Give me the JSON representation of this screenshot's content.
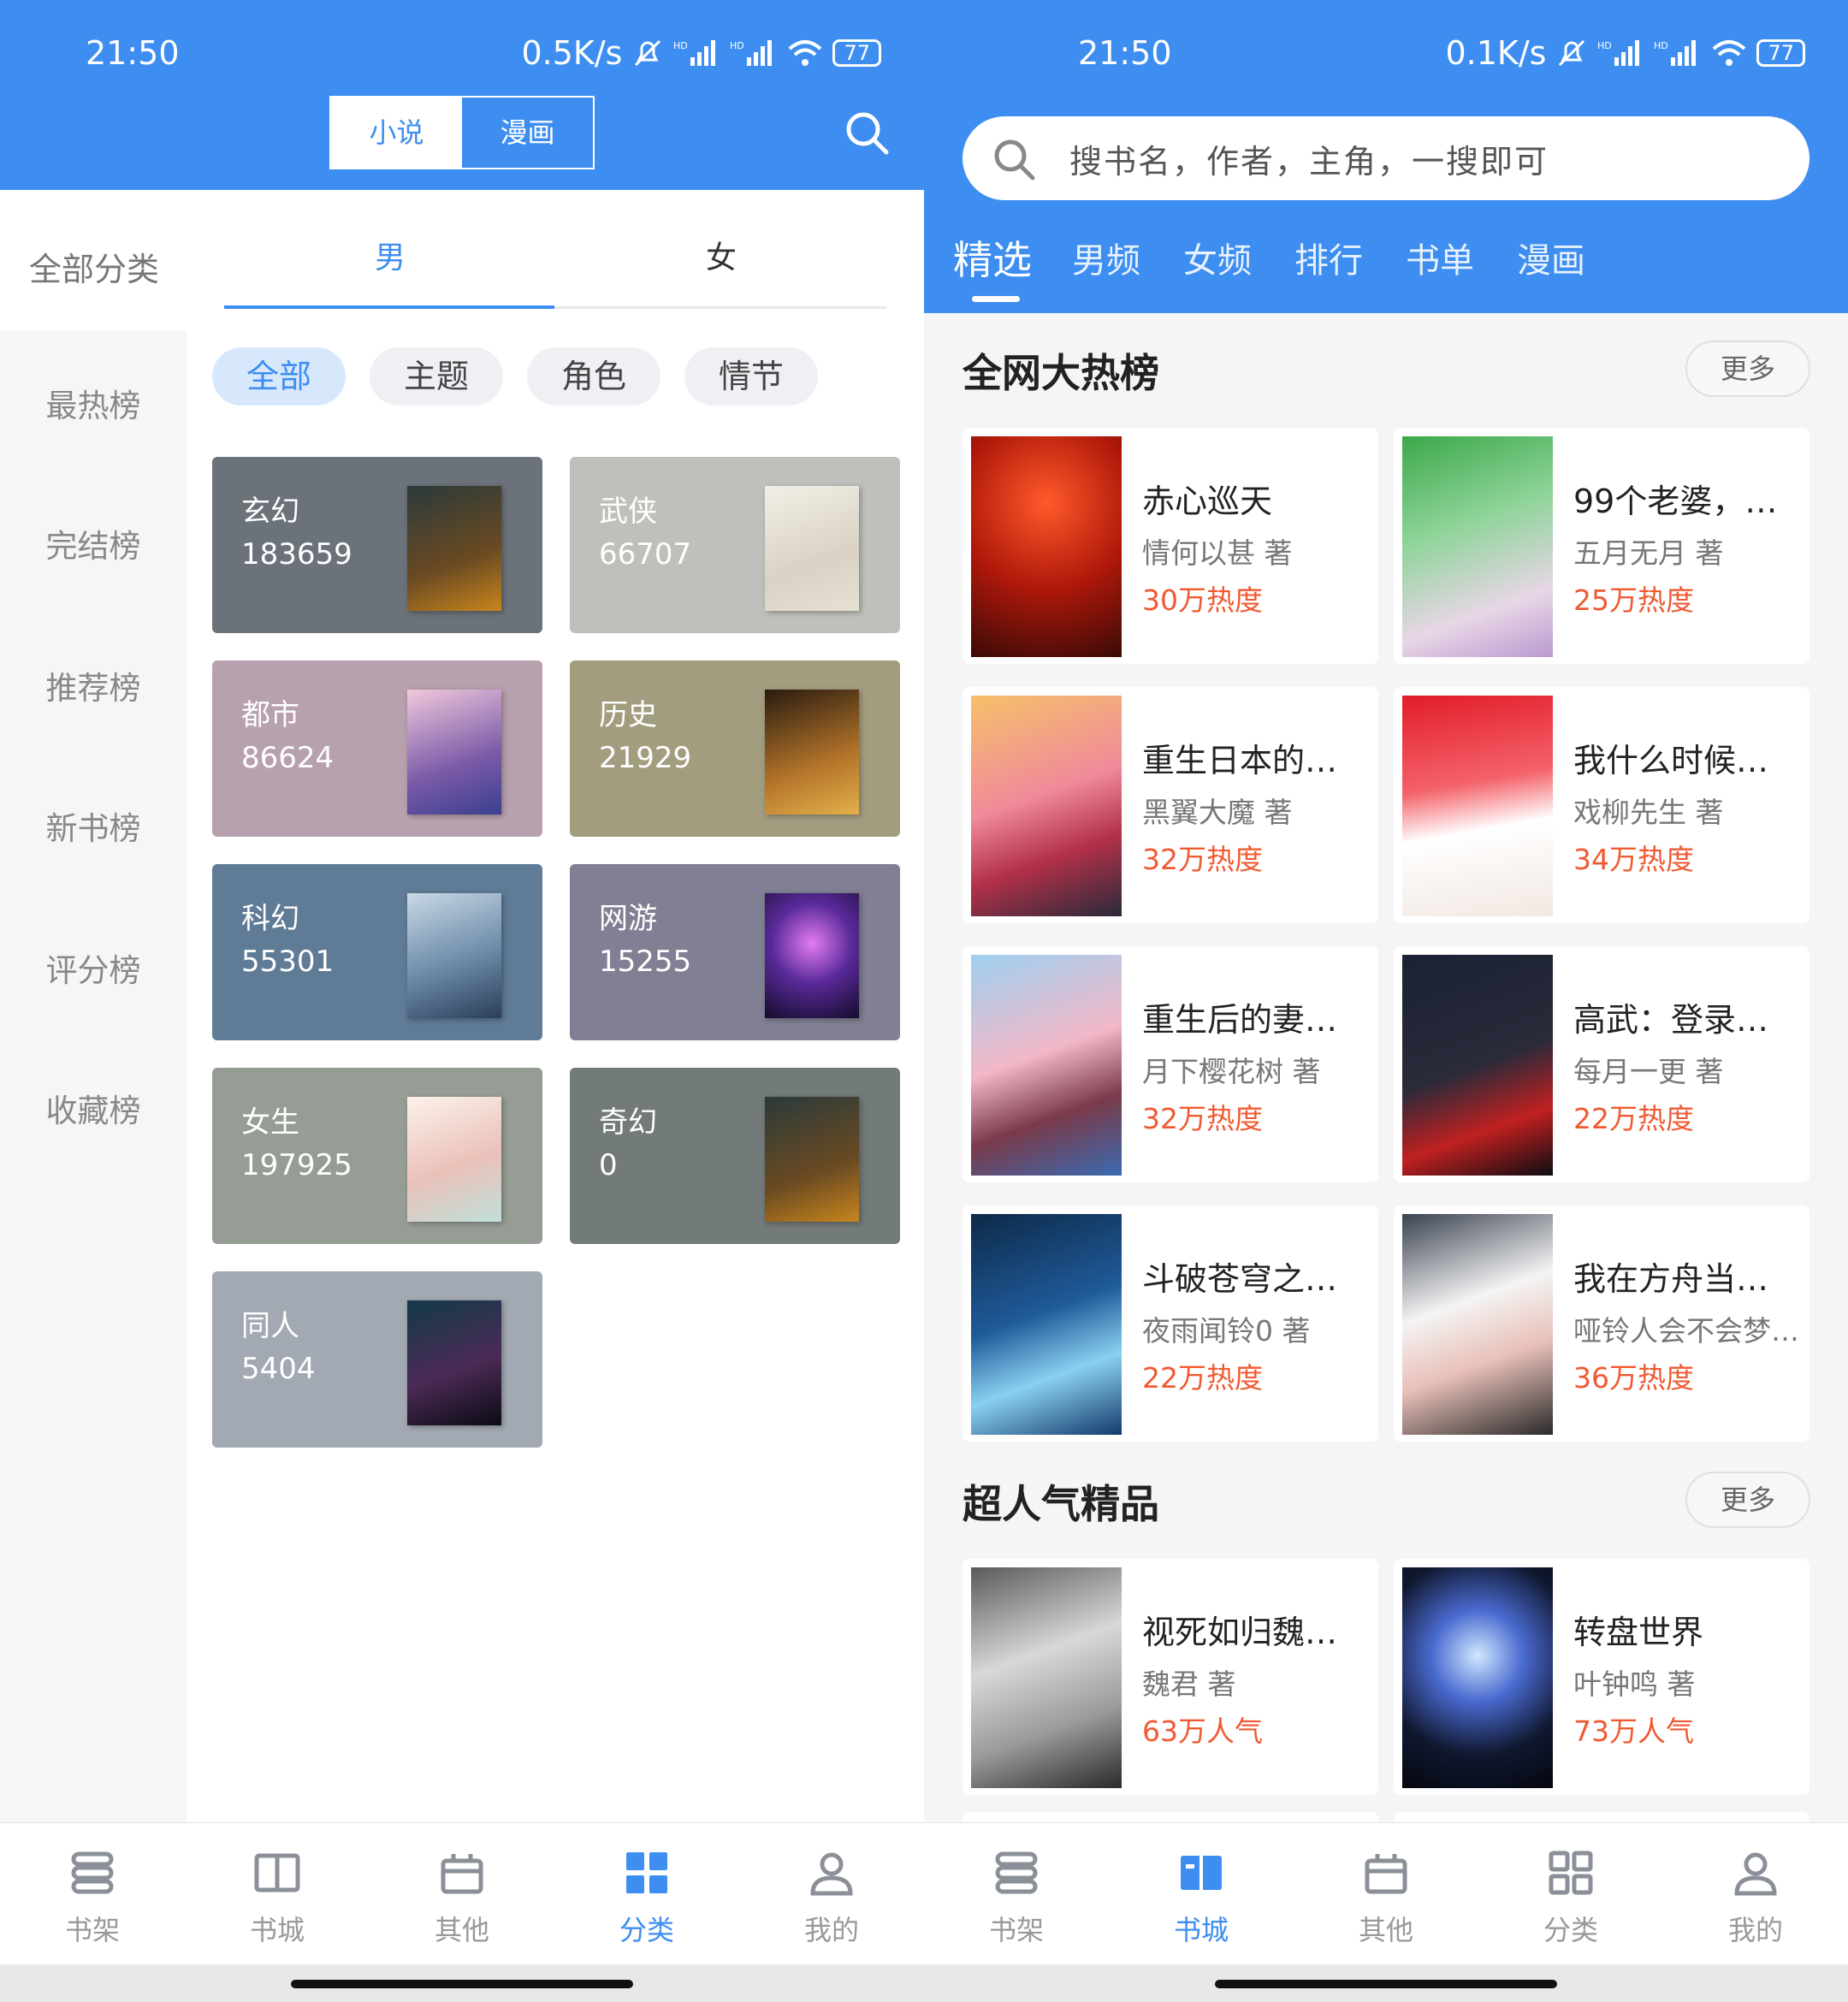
{
  "left": {
    "status": {
      "time": "21:50",
      "speed": "0.5K/s",
      "battery": "77"
    },
    "toggle": {
      "novel": "小说",
      "comic": "漫画"
    },
    "header": {
      "all_category": "全部分类",
      "male": "男",
      "female": "女"
    },
    "sidebar": [
      {
        "label": "最热榜"
      },
      {
        "label": "完结榜"
      },
      {
        "label": "推荐榜"
      },
      {
        "label": "新书榜"
      },
      {
        "label": "评分榜"
      },
      {
        "label": "收藏榜"
      }
    ],
    "chips": [
      {
        "label": "全部"
      },
      {
        "label": "主题"
      },
      {
        "label": "角色"
      },
      {
        "label": "情节"
      }
    ],
    "categories": [
      {
        "name": "玄幻",
        "count": "183659",
        "color": "#6b7279"
      },
      {
        "name": "武侠",
        "count": "66707",
        "color": "#bfc0bb"
      },
      {
        "name": "都市",
        "count": "86624",
        "color": "#b8a1ae"
      },
      {
        "name": "历史",
        "count": "21929",
        "color": "#a39d80"
      },
      {
        "name": "科幻",
        "count": "55301",
        "color": "#5f7b95"
      },
      {
        "name": "网游",
        "count": "15255",
        "color": "#807f93"
      },
      {
        "name": "女生",
        "count": "197925",
        "color": "#969d95"
      },
      {
        "name": "奇幻",
        "count": "0",
        "color": "#737a7a"
      },
      {
        "name": "同人",
        "count": "5404",
        "color": "#a2a9b2"
      }
    ],
    "nav": [
      {
        "label": "书架"
      },
      {
        "label": "书城"
      },
      {
        "label": "其他"
      },
      {
        "label": "分类"
      },
      {
        "label": "我的"
      }
    ]
  },
  "right": {
    "status": {
      "time": "21:50",
      "speed": "0.1K/s",
      "battery": "77"
    },
    "search": {
      "placeholder": "搜书名，作者，主角，一搜即可"
    },
    "tabs": [
      {
        "label": "精选"
      },
      {
        "label": "男频"
      },
      {
        "label": "女频"
      },
      {
        "label": "排行"
      },
      {
        "label": "书单"
      },
      {
        "label": "漫画"
      }
    ],
    "hot": {
      "title": "全网大热榜",
      "more": "更多",
      "books": [
        {
          "title": "赤心巡天",
          "author": "情何以甚 著",
          "heat": "30万热度"
        },
        {
          "title": "99个老婆，…",
          "author": "五月无月 著",
          "heat": "25万热度"
        },
        {
          "title": "重生日本的…",
          "author": "黑翼大魔 著",
          "heat": "32万热度"
        },
        {
          "title": "我什么时候…",
          "author": "戏柳先生 著",
          "heat": "34万热度"
        },
        {
          "title": "重生后的妻…",
          "author": "月下樱花树 著",
          "heat": "32万热度"
        },
        {
          "title": "高武：登录…",
          "author": "每月一更 著",
          "heat": "22万热度"
        },
        {
          "title": "斗破苍穹之…",
          "author": "夜雨闻铃0 著",
          "heat": "22万热度"
        },
        {
          "title": "我在方舟当…",
          "author": "哑铃人会不会梦…",
          "heat": "36万热度"
        }
      ]
    },
    "popular": {
      "title": "超人气精品",
      "more": "更多",
      "books": [
        {
          "title": "视死如归魏…",
          "author": "魏君 著",
          "heat": "63万人气"
        },
        {
          "title": "转盘世界",
          "author": "叶钟鸣 著",
          "heat": "73万人气"
        }
      ]
    },
    "nav": [
      {
        "label": "书架"
      },
      {
        "label": "书城"
      },
      {
        "label": "其他"
      },
      {
        "label": "分类"
      },
      {
        "label": "我的"
      }
    ]
  }
}
